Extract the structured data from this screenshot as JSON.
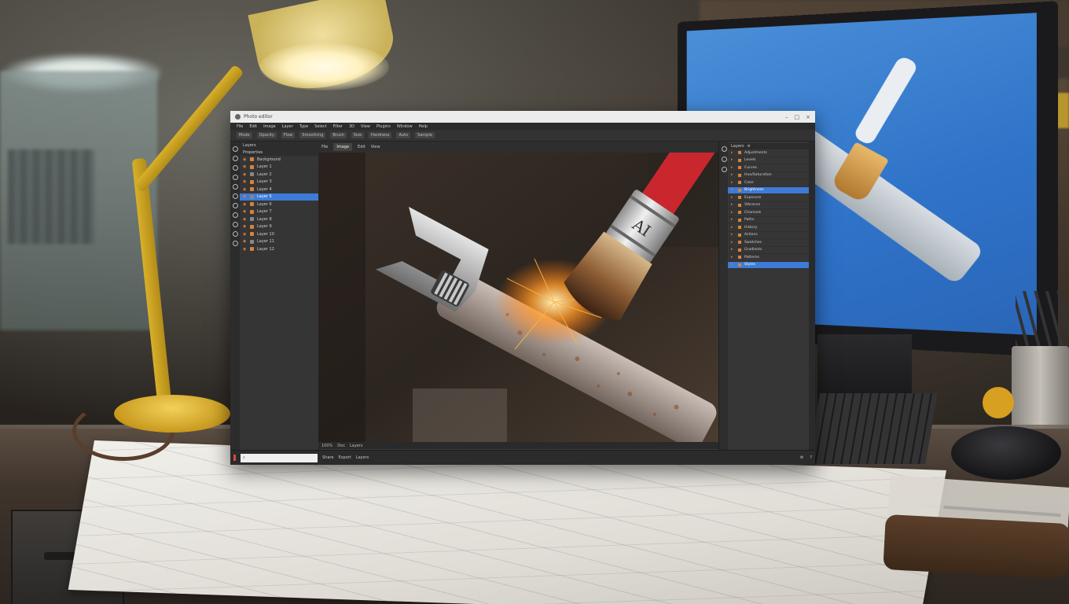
{
  "app": {
    "title": "Photo editor",
    "window_controls": [
      "–",
      "□",
      "×"
    ],
    "menu": [
      "File",
      "Edit",
      "Image",
      "Layer",
      "Type",
      "Select",
      "Filter",
      "3D",
      "View",
      "Plugins",
      "Window",
      "Help"
    ],
    "options": [
      "Mode",
      "Opacity",
      "Flow",
      "Smoothing",
      "Brush",
      "Size",
      "Hardness",
      "Auto",
      "Sample"
    ],
    "tabs": [
      {
        "label": "File",
        "active": false
      },
      {
        "label": "Image",
        "active": true
      },
      {
        "label": "Edit",
        "active": false
      },
      {
        "label": "View",
        "active": false
      }
    ]
  },
  "left_panel": {
    "header": "Layers",
    "subheader": "Properties",
    "rows": [
      {
        "label": "Background",
        "selected": false
      },
      {
        "label": "Layer 1",
        "selected": false
      },
      {
        "label": "Layer 2",
        "selected": false
      },
      {
        "label": "Layer 3",
        "selected": false
      },
      {
        "label": "Layer 4",
        "selected": false
      },
      {
        "label": "Layer 5",
        "selected": true
      },
      {
        "label": "Layer 6",
        "selected": false
      },
      {
        "label": "Layer 7",
        "selected": false
      },
      {
        "label": "Layer 8",
        "selected": false
      },
      {
        "label": "Layer 9",
        "selected": false
      },
      {
        "label": "Layer 10",
        "selected": false
      },
      {
        "label": "Layer 11",
        "selected": false
      },
      {
        "label": "Layer 12",
        "selected": false
      }
    ]
  },
  "canvas": {
    "brush_ferrule_text": "AI"
  },
  "right_panel": {
    "header": "Layers",
    "rows": [
      {
        "label": "Adjustments",
        "selected": false
      },
      {
        "label": "Levels",
        "selected": false
      },
      {
        "label": "Curves",
        "selected": false
      },
      {
        "label": "Hue/Saturation",
        "selected": false
      },
      {
        "label": "Color",
        "selected": false
      },
      {
        "label": "Brightness",
        "selected": true
      },
      {
        "label": "Exposure",
        "selected": false
      },
      {
        "label": "Vibrance",
        "selected": false
      },
      {
        "label": "Channels",
        "selected": false
      },
      {
        "label": "Paths",
        "selected": false
      },
      {
        "label": "History",
        "selected": false
      },
      {
        "label": "Actions",
        "selected": false
      },
      {
        "label": "Swatches",
        "selected": false
      },
      {
        "label": "Gradients",
        "selected": false
      },
      {
        "label": "Patterns",
        "selected": false
      },
      {
        "label": "Styles",
        "selected": true
      }
    ]
  },
  "canvas_status": [
    "100%",
    "Doc",
    "Layers"
  ],
  "bottom": {
    "items": [
      "Share",
      "Export",
      "Layers"
    ]
  }
}
